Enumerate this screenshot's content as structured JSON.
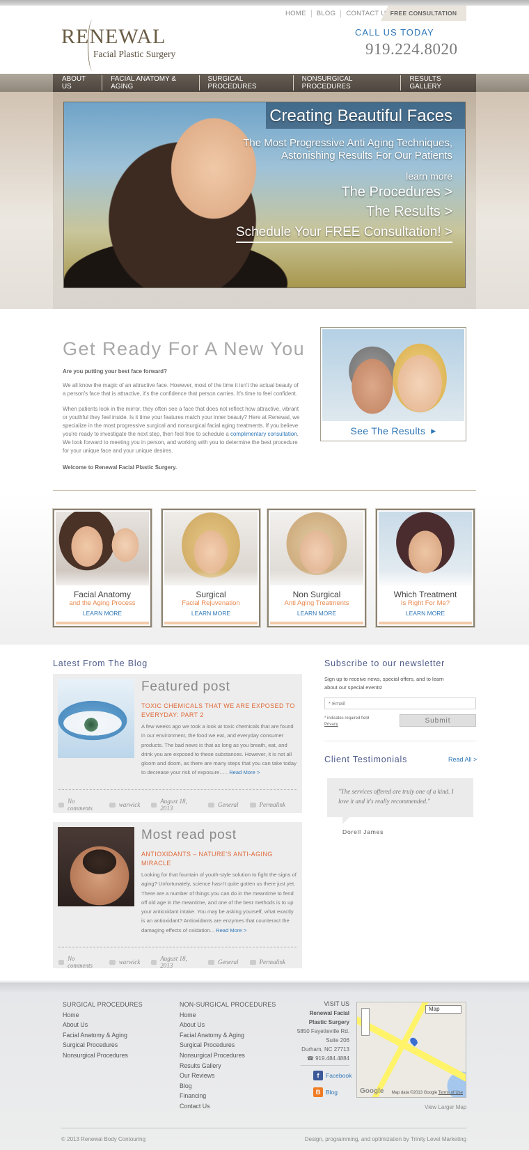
{
  "header": {
    "logo_main": "RENEWAL",
    "logo_sub": "Facial Plastic Surgery",
    "top_links": [
      "HOME",
      "BLOG",
      "CONTACT US"
    ],
    "free_consult": "FREE CONSULTATION",
    "call_label": "CALL US TODAY",
    "phone": "919.224.8020"
  },
  "nav": {
    "items": [
      "ABOUT US",
      "FACIAL ANATOMY & AGING",
      "SURGICAL PROCEDURES",
      "NONSURGICAL PROCEDURES",
      "RESULTS GALLERY"
    ]
  },
  "hero": {
    "title": "Creating Beautiful Faces",
    "subtitle1": "The Most Progressive Anti Aging Techniques,",
    "subtitle2": "Astonishing Results For Our Patients",
    "learn_more": "learn more",
    "procedures_link": "The Procedures >",
    "results_link": "The Results >",
    "schedule_link": "Schedule Your FREE Consultation! >"
  },
  "intro": {
    "heading": "Get Ready For A New You",
    "question": "Are you putting your best face forward?",
    "para1": "We all know the magic of an attractive face. However, most of the time it isn't the actual beauty of a person's face that is attractive, it's the confidence that person carries. It's time to feel confident.",
    "para2_a": "When patients look in the mirror, they often see a face that does not reflect how attractive, vibrant or youthful they feel inside. Is it time your features match your inner beauty? Here at Renewal, we specialize in the most progressive surgical and nonsurgical facial aging treatments. If you believe you're ready to investigate the next step, then feel free to schedule a ",
    "para2_link": "complimentary consultation",
    "para2_b": ". We look forward to meeting you in person, and working with you to determine the best procedure for your unique face and your unique desires.",
    "welcome": "Welcome to Renewal Facial Plastic Surgery.",
    "results_button": "See The Results"
  },
  "tiles": [
    {
      "title": "Facial Anatomy",
      "subtitle": "and the Aging Process",
      "link": "LEARN MORE"
    },
    {
      "title": "Surgical",
      "subtitle": "Facial Rejuvenation",
      "link": "LEARN MORE"
    },
    {
      "title": "Non Surgical",
      "subtitle": "Anti Aging Treatments",
      "link": "LEARN MORE"
    },
    {
      "title": "Which Treatment",
      "subtitle": "Is Right For Me?",
      "link": "LEARN MORE"
    }
  ],
  "blog": {
    "heading": "Latest From The Blog",
    "posts": [
      {
        "type": "Featured post",
        "title": "TOXIC CHEMICALS THAT WE ARE EXPOSED TO EVERYDAY: PART 2",
        "body": "A few weeks ago we took a look at toxic chemicals that are found in our environment, the food we eat, and everyday consumer products. The bad news is that as long as you breath, eat, and drink you are exposed to these substances. However, it is not all gloom and doom, as there are many steps that you can take today to decrease your risk of exposure….. ",
        "read_more": "Read More >",
        "comments": "No comments",
        "author": "warwick",
        "date": "August 18, 2013",
        "category": "General",
        "permalink": "Permalink"
      },
      {
        "type": "Most read post",
        "title": "ANTIOXIDANTS – NATURE'S ANTI-AGING MIRACLE",
        "body": "Looking for that fountain of youth-style solution to fight the signs of aging? Unfortunately, science hasn't quite gotten us there just yet. There are a number of things you can do in the meantime to fend off old age in the meantime, and one of the best methods is to up your antioxidant intake. You may be asking yourself, what exactly is an antioxidant? Antioxidants are enzymes that counteract the damaging effects of oxidation... ",
        "read_more": "Read More >",
        "comments": "No comments",
        "author": "warwick",
        "date": "August 18, 2013",
        "category": "General",
        "permalink": "Permalink"
      }
    ]
  },
  "newsletter": {
    "heading": "Subscribe to our newsletter",
    "text": "Sign up to receive news, special offers, and to learn about our special events!",
    "email_placeholder": "* Email",
    "required_note": "* indicates required field",
    "privacy": "Privacy",
    "submit": "Submit"
  },
  "testimonials": {
    "heading": "Client Testimonials",
    "read_all": "Read All >",
    "quote": "\"The services offered are truly one of a kind. I love it and it's really recommended.\"",
    "author": "Dorell James"
  },
  "footer": {
    "surgical": {
      "heading": "SURGICAL PROCEDURES",
      "links": [
        "Home",
        "About Us",
        "Facial Anatomy & Aging",
        "Surgical Procedures",
        "Nonsurgical Procedures"
      ]
    },
    "nonsurgical": {
      "heading": "NON-SURGICAL PROCEDURES",
      "links": [
        "Home",
        "About Us",
        "Facial Anatomy & Aging",
        "Surgical Procedures",
        "Nonsurgical Procedures",
        "Results Gallery",
        "Our Reviews",
        "Blog",
        "Financing",
        "Contact Us"
      ]
    },
    "visit": {
      "heading": "VISIT US",
      "name1": "Renewal Facial",
      "name2": "Plastic Surgery",
      "addr1": "5850 Fayetteville Rd.",
      "addr2": "Suite 206",
      "addr3": "Durham, NC 27713",
      "phone": "☎ 919.484.4884"
    },
    "social": {
      "facebook": "Facebook",
      "blog": "Blog"
    },
    "map": {
      "type_select": "Map",
      "brand": "Google",
      "copyright": "Map data ©2013 Google",
      "terms": "Terms of Use"
    },
    "view_larger_map": "View Larger Map",
    "copyright": "© 2013 Renewal Body Contouring",
    "credits": "Design, programming, and optimization by Trinity Level Marketing"
  },
  "colors": {
    "accent_blue": "#2f77b7",
    "accent_orange": "#e06a3a",
    "nav_bg": "#5a5249",
    "heading_blue": "#4d5a8a"
  }
}
